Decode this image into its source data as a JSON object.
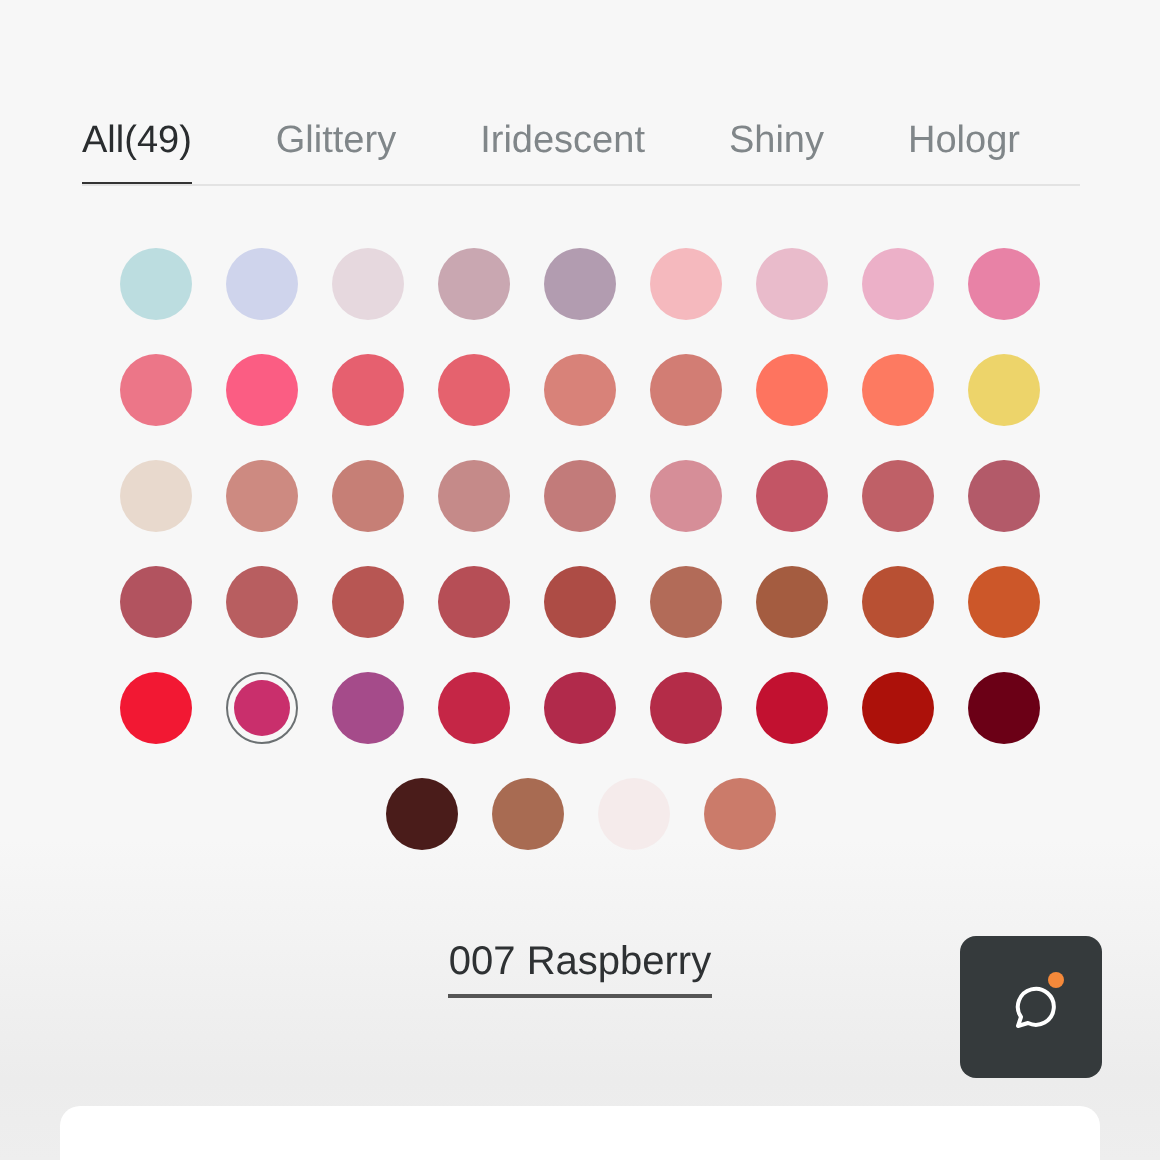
{
  "tabs": [
    {
      "label": "All(49)",
      "selected": true
    },
    {
      "label": "Glittery",
      "selected": false
    },
    {
      "label": "Iridescent",
      "selected": false
    },
    {
      "label": "Shiny",
      "selected": false
    },
    {
      "label": "Hologr",
      "selected": false
    }
  ],
  "swatches": [
    {
      "color": "#bcdde0",
      "selected": false
    },
    {
      "color": "#cfd4ec",
      "selected": false
    },
    {
      "color": "#e6d8de",
      "selected": false
    },
    {
      "color": "#c9a7b1",
      "selected": false
    },
    {
      "color": "#b29cb0",
      "selected": false
    },
    {
      "color": "#f5b9be",
      "selected": false
    },
    {
      "color": "#e9bbcb",
      "selected": false
    },
    {
      "color": "#ecb0c8",
      "selected": false
    },
    {
      "color": "#e882a6",
      "selected": false
    },
    {
      "color": "#ec7688",
      "selected": false
    },
    {
      "color": "#fb5d83",
      "selected": false
    },
    {
      "color": "#e6606f",
      "selected": false
    },
    {
      "color": "#e5626e",
      "selected": false
    },
    {
      "color": "#d88279",
      "selected": false
    },
    {
      "color": "#d27d74",
      "selected": false
    },
    {
      "color": "#fe745f",
      "selected": false
    },
    {
      "color": "#fd7a61",
      "selected": false
    },
    {
      "color": "#edd46a",
      "selected": false
    },
    {
      "color": "#e8d9cd",
      "selected": false
    },
    {
      "color": "#cd8a81",
      "selected": false
    },
    {
      "color": "#c67f76",
      "selected": false
    },
    {
      "color": "#c58a89",
      "selected": false
    },
    {
      "color": "#c27b7a",
      "selected": false
    },
    {
      "color": "#d68e98",
      "selected": false
    },
    {
      "color": "#c35565",
      "selected": false
    },
    {
      "color": "#bf6067",
      "selected": false
    },
    {
      "color": "#b35a69",
      "selected": false
    },
    {
      "color": "#b2535f",
      "selected": false
    },
    {
      "color": "#b85e60",
      "selected": false
    },
    {
      "color": "#b75653",
      "selected": false
    },
    {
      "color": "#b64e56",
      "selected": false
    },
    {
      "color": "#ad4c45",
      "selected": false
    },
    {
      "color": "#b26b58",
      "selected": false
    },
    {
      "color": "#a45c40",
      "selected": false
    },
    {
      "color": "#b85033",
      "selected": false
    },
    {
      "color": "#cc5729",
      "selected": false
    },
    {
      "color": "#f21833",
      "selected": false
    },
    {
      "color": "#c92f6c",
      "selected": true
    },
    {
      "color": "#a54b8a",
      "selected": false
    },
    {
      "color": "#c52646",
      "selected": false
    },
    {
      "color": "#b12a4b",
      "selected": false
    },
    {
      "color": "#b42c48",
      "selected": false
    },
    {
      "color": "#c21130",
      "selected": false
    },
    {
      "color": "#ac110a",
      "selected": false
    },
    {
      "color": "#6b0016",
      "selected": false
    },
    {
      "color": "#4a1c1a",
      "selected": false
    },
    {
      "color": "#a86b52",
      "selected": false
    },
    {
      "color": "#f5ebeb",
      "selected": false
    },
    {
      "color": "#cb7b6a",
      "selected": false
    }
  ],
  "selected_shade": "007 Raspberry",
  "chat_button": {
    "notification": true
  }
}
